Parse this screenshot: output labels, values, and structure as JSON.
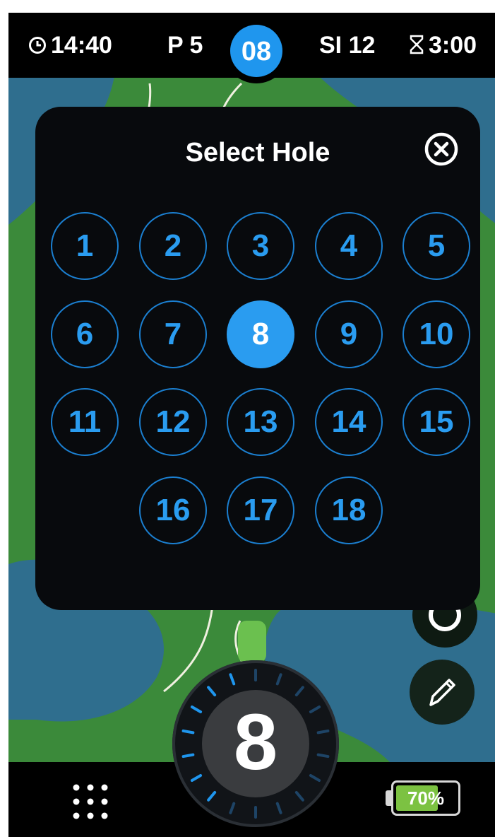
{
  "status_bar": {
    "time": "14:40",
    "par": "P 5",
    "current_hole": "08",
    "stroke_index": "SI 12",
    "timer": "3:00"
  },
  "dialog": {
    "title": "Select Hole",
    "close_icon": "close-circle-icon",
    "holes": [
      "1",
      "2",
      "3",
      "4",
      "5",
      "6",
      "7",
      "8",
      "9",
      "10",
      "11",
      "12",
      "13",
      "14",
      "15",
      "16",
      "17",
      "18"
    ],
    "selected_hole": "8"
  },
  "side_buttons": {
    "edit_icon": "pencil-icon"
  },
  "dial": {
    "hole_number": "8"
  },
  "bottom_bar": {
    "menu_icon": "grid-dots-icon",
    "battery_level": "70%",
    "battery_fraction": 0.7
  },
  "colors": {
    "accent": "#2a9cf0",
    "fairway": "#3b8a3a",
    "water": "#2f6e8e",
    "battery": "#7cc242"
  }
}
